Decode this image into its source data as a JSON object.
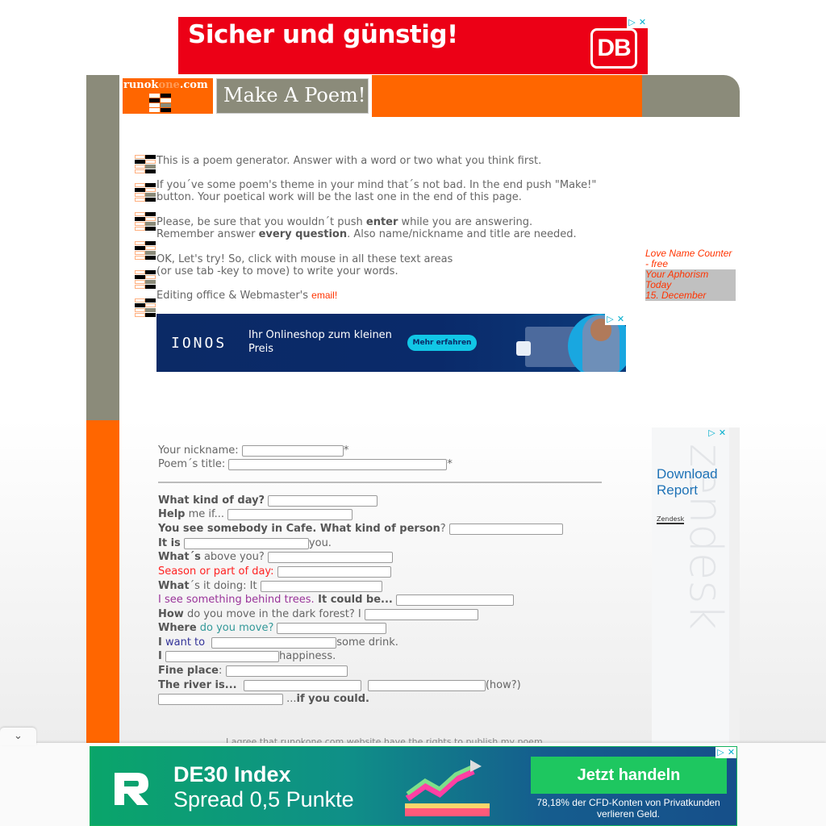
{
  "ads": {
    "top": {
      "headline": "Sicher und günstig!",
      "brand": "DB",
      "adchoice_play": "▷",
      "adchoice_close": "✕"
    },
    "ionos": {
      "brand": "IONOS",
      "copy_line1": "Ihr Onlineshop zum kleinen",
      "copy_line2": "Preis",
      "cta": "Mehr erfahren",
      "adchoice_play": "▷",
      "adchoice_close": "✕"
    },
    "zendesk": {
      "cta_line1": "Download",
      "cta_line2": "Report",
      "brand": "Zendesk",
      "watermark": "zendesk",
      "adchoice_play": "▷",
      "adchoice_close": "✕"
    },
    "bottom": {
      "headline": "DE30 Index",
      "subline": "Spread 0,5 Punkte",
      "cta": "Jetzt handeln",
      "disclaimer": "78,18% der CFD-Konten von Privatkunden verlieren Geld.",
      "adchoice_play": "▷",
      "adchoice_close": "✕"
    }
  },
  "header": {
    "logo_left": "runok",
    "logo_mid": "one",
    "logo_right": ".com",
    "title": "Make A Poem!"
  },
  "intro": {
    "p1": "This is a poem generator. Answer with a word or two what you think first.",
    "p2_line1": "If you´ve some poem's theme in your mind that´s not bad. In the end push \"Make!\"",
    "p2_line2": "button. Your poetical work will be the last one in the end of this page.",
    "p3_a": "Please, be sure that you wouldn´t push ",
    "p3_b": "enter",
    "p3_c": " while you are answering.",
    "p3_line2_a": "Remember answer ",
    "p3_line2_b": "every question",
    "p3_line2_c": ". Also name/nickname and title are needed.",
    "p4_line1": "OK, Let's try! So, click with mouse in all these text areas",
    "p4_line2": "(or use tab -key to move) to write your words.",
    "p5": "Editing office & Webmaster's ",
    "p5_link": "email!"
  },
  "side_links": {
    "love_counter": "Love Name Counter - free",
    "aphorism_line1": "Your Aphorism Today",
    "aphorism_line2": "15. December"
  },
  "form": {
    "nickname_label": "Your nickname:",
    "title_label": "Poem´s title:",
    "required_mark": "*",
    "q1_bold": "What kind of day?",
    "q2_bold": "Help",
    "q2_rest": " me if...",
    "q3_bold": "You see somebody in Cafe. What kind of person",
    "q3_rest": "?",
    "q4_bold": "It is",
    "q4_after": "you.",
    "q5_bold": "What´s",
    "q5_rest": " above you?",
    "q6": "Season or part of day:",
    "q7_bold": "What",
    "q7_rest": "´s it doing: It",
    "q8_a": "I see something behind trees.",
    "q8_bold": " It could be...",
    "q9_bold": "How",
    "q9_rest": " do you move in the dark forest? I",
    "q10_bold": "Where",
    "q10_rest": " do you move?",
    "q11_bold": "I",
    "q11_rest": " want to",
    "q11_after": "some drink.",
    "q12_bold": "I",
    "q12_after": "happiness.",
    "q13_bold": "Fine place",
    "q13_rest": ":",
    "q14_bold": "The river is...",
    "q14_after": "(how?)",
    "q15_pre": "...",
    "q15_bold": "if you could.",
    "agree": "I agree that runokone.com website have the rights to publish my poem"
  },
  "anchor": {
    "collapse_icon": "⌄"
  },
  "colors": {
    "orange": "#ff6600",
    "gray": "#8b8b7a",
    "red_link": "#ff3300",
    "season_red": "#ff2222",
    "purple": "#993399",
    "teal": "#339999",
    "navy": "#333399"
  }
}
